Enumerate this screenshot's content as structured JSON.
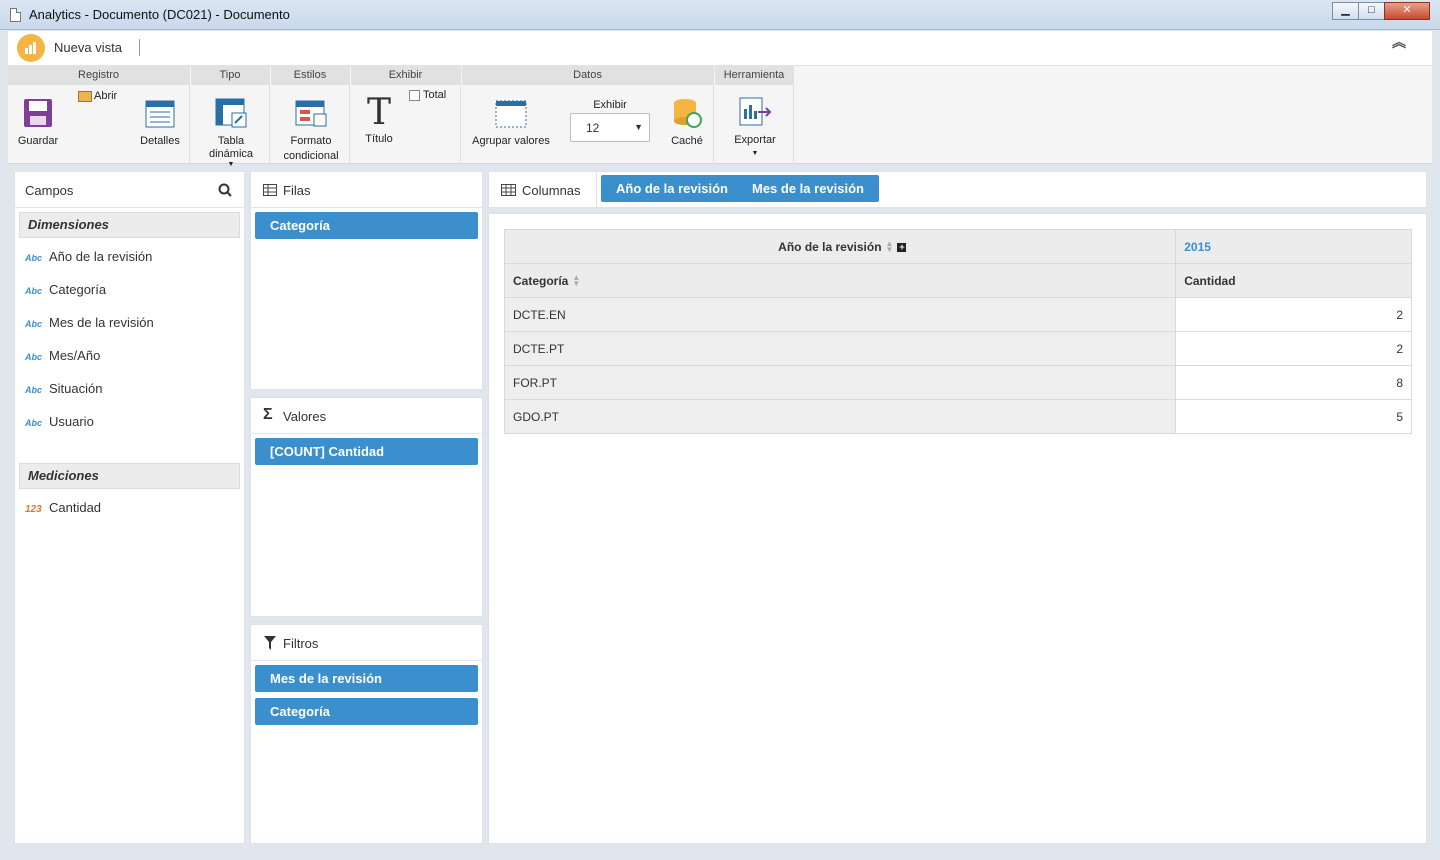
{
  "window": {
    "title": "Analytics - Documento (DC021) - Documento",
    "minimize": "▁",
    "maximize": "□",
    "close": "✕"
  },
  "header": {
    "view_title": "Nueva vista",
    "collapse_icon": "double-chevron-up"
  },
  "ribbon": {
    "groups": {
      "registro": "Registro",
      "tipo": "Tipo",
      "estilos": "Estilos",
      "exhibir": "Exhibir",
      "datos": "Datos",
      "herramienta": "Herramienta"
    },
    "buttons": {
      "guardar": "Guardar",
      "abrir": "Abrir",
      "detalles": "Detalles",
      "tabla_dinamica_1": "Tabla",
      "tabla_dinamica_2": "dinámica",
      "formato_1": "Formato",
      "formato_2": "condicional",
      "titulo": "Título",
      "total": "Total",
      "agrupar": "Agrupar valores",
      "exhibir_label": "Exhibir",
      "exhibir_value": "12",
      "cache": "Caché",
      "exportar": "Exportar"
    }
  },
  "campos": {
    "title": "Campos",
    "dimensiones_title": "Dimensiones",
    "dimensiones": [
      {
        "tag": "Abc",
        "label": "Año de la revisión"
      },
      {
        "tag": "Abc",
        "label": "Categoría"
      },
      {
        "tag": "Abc",
        "label": "Mes de la revisión"
      },
      {
        "tag": "Abc",
        "label": "Mes/Año"
      },
      {
        "tag": "Abc",
        "label": "Situación"
      },
      {
        "tag": "Abc",
        "label": "Usuario"
      }
    ],
    "mediciones_title": "Mediciones",
    "mediciones": [
      {
        "tag": "123",
        "label": "Cantidad"
      }
    ]
  },
  "filas": {
    "title": "Filas",
    "items": [
      "Categoría"
    ]
  },
  "valores": {
    "title": "Valores",
    "items": [
      "[COUNT] Cantidad"
    ]
  },
  "filtros": {
    "title": "Filtros",
    "items": [
      "Mes de la revisión",
      "Categoría"
    ]
  },
  "columnas": {
    "title": "Columnas",
    "items": [
      "Año de la revisión",
      "Mes de la revisión"
    ]
  },
  "pivot": {
    "col_field": "Año de la revisión",
    "year": "2015",
    "row_field": "Categoría",
    "measure": "Cantidad",
    "rows": [
      {
        "label": "DCTE.EN",
        "value": "2"
      },
      {
        "label": "DCTE.PT",
        "value": "2"
      },
      {
        "label": "FOR.PT",
        "value": "8"
      },
      {
        "label": "GDO.PT",
        "value": "5"
      }
    ]
  }
}
